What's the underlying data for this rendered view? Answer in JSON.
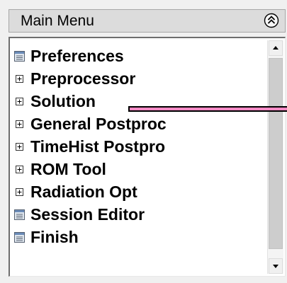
{
  "header": {
    "title": "Main Menu",
    "collapse_icon": "double-chevron-up-icon"
  },
  "menu": {
    "items": [
      {
        "label": "Preferences",
        "icon": "dialog-window-icon"
      },
      {
        "label": "Preprocessor",
        "icon": "expand-plus-icon"
      },
      {
        "label": "Solution",
        "icon": "expand-plus-icon"
      },
      {
        "label": "General Postproc",
        "icon": "expand-plus-icon"
      },
      {
        "label": "TimeHist Postpro",
        "icon": "expand-plus-icon"
      },
      {
        "label": "ROM Tool",
        "icon": "expand-plus-icon"
      },
      {
        "label": "Radiation Opt",
        "icon": "expand-plus-icon"
      },
      {
        "label": "Session Editor",
        "icon": "dialog-window-icon"
      },
      {
        "label": "Finish",
        "icon": "dialog-window-icon"
      }
    ]
  },
  "annotation": {
    "pointer_color": "#f48ac4"
  }
}
